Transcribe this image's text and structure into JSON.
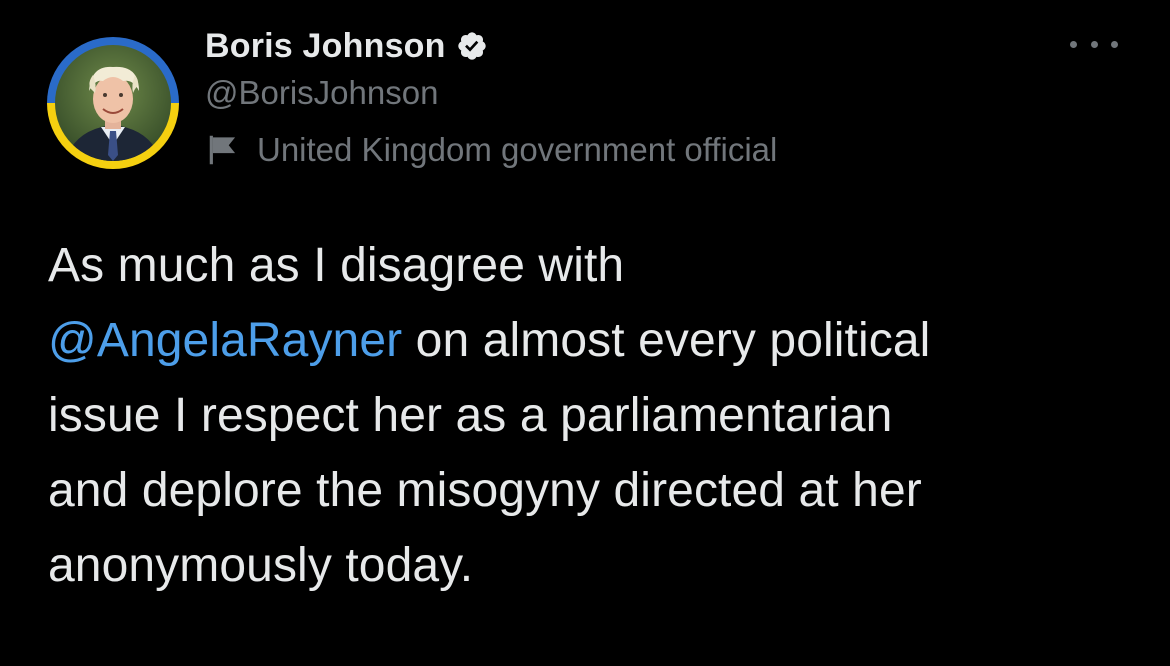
{
  "author": {
    "name": "Boris Johnson",
    "handle": "@BorisJohnson",
    "verified": true,
    "affiliation": "United Kingdom government official",
    "avatar_ring_colors": [
      "#f5d010",
      "#2a6bc9"
    ]
  },
  "icons": {
    "verified": "verified-badge-icon",
    "affiliation": "flag-icon",
    "menu": "more-options-icon"
  },
  "tweet": {
    "line1": "As much as I disagree with",
    "mention": "@AngelaRayner",
    "line2_rest": " on almost every political",
    "line3": "issue I respect her as a parliamentarian",
    "line4": "and deplore the misogyny directed at her",
    "line5": "anonymously today."
  },
  "colors": {
    "background": "#000000",
    "text": "#e7e9ea",
    "secondary": "#71767b",
    "link": "#4d9ee9"
  }
}
